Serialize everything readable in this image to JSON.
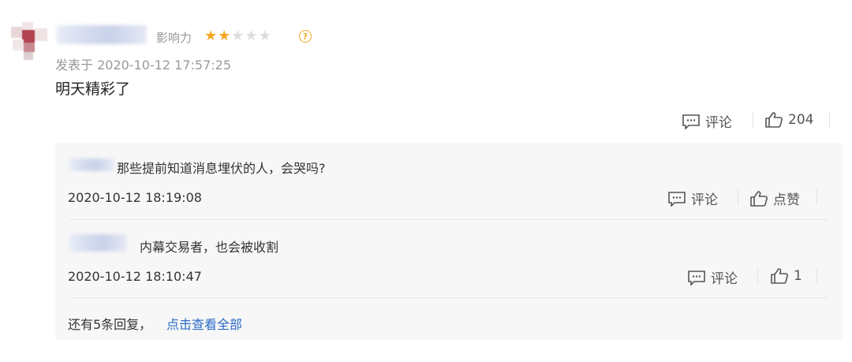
{
  "comment": {
    "influence_label": "影响力",
    "rating": 2,
    "rating_max": 5,
    "help_symbol": "?",
    "posted_at": "发表于 2020-10-12 17:57:25",
    "text": "明天精彩了",
    "actions": {
      "comment_label": "评论",
      "like_count": "204"
    }
  },
  "replies": [
    {
      "text": "那些提前知道消息埋伏的人，会哭吗?",
      "time": "2020-10-12 18:19:08",
      "comment_label": "评论",
      "like_label": "点赞"
    },
    {
      "text": "内幕交易者，也会被收割",
      "time": "2020-10-12 18:10:47",
      "comment_label": "评论",
      "like_label": "1"
    }
  ],
  "more_replies": {
    "text": "还有5条回复，",
    "link": "点击查看全部"
  },
  "colors": {
    "star_active": "#f5a623",
    "star_inactive": "#dcdcdc",
    "link": "#2a6bc8",
    "reply_bg": "#f7f7f7"
  },
  "icons": [
    "comment-icon",
    "thumbs-up-icon",
    "star-icon",
    "help-icon"
  ]
}
